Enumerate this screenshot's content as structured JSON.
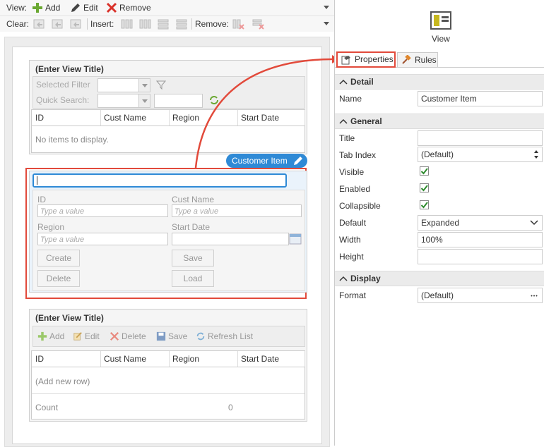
{
  "toolbar": {
    "view_label": "View:",
    "add": "Add",
    "edit": "Edit",
    "remove": "Remove",
    "clear_label": "Clear:",
    "insert_label": "Insert:",
    "remove2_label": "Remove:"
  },
  "list_view": {
    "title": "(Enter View Title)",
    "selected_filter": "Selected Filter",
    "quick_search": "Quick Search:",
    "columns": [
      "ID",
      "Cust Name",
      "Region",
      "Start Date"
    ],
    "empty": "No items to display."
  },
  "item_view": {
    "badge": "Customer Item",
    "labels": {
      "id": "ID",
      "cust_name": "Cust Name",
      "region": "Region",
      "start_date": "Start Date"
    },
    "placeholder": "Type a value",
    "buttons": {
      "create": "Create",
      "save": "Save",
      "delete": "Delete",
      "load": "Load"
    }
  },
  "edit_list_view": {
    "title": "(Enter View Title)",
    "actions": {
      "add": "Add",
      "edit": "Edit",
      "delete": "Delete",
      "save": "Save",
      "refresh": "Refresh List"
    },
    "columns": [
      "ID",
      "Cust Name",
      "Region",
      "Start Date"
    ],
    "add_row": "(Add new row)",
    "count_label": "Count",
    "count_value": "0"
  },
  "panel": {
    "view_label": "View",
    "tabs": {
      "properties": "Properties",
      "rules": "Rules"
    },
    "sections": {
      "detail": "Detail",
      "general": "General",
      "display": "Display"
    },
    "props": {
      "name_label": "Name",
      "name_value": "Customer Item",
      "title_label": "Title",
      "title_value": "",
      "tabindex_label": "Tab Index",
      "tabindex_value": "(Default)",
      "visible_label": "Visible",
      "enabled_label": "Enabled",
      "collapsible_label": "Collapsible",
      "default_label": "Default",
      "default_value": "Expanded",
      "width_label": "Width",
      "width_value": "100%",
      "height_label": "Height",
      "height_value": "",
      "format_label": "Format",
      "format_value": "(Default)"
    }
  },
  "colors": {
    "accent_red": "#e24a3b",
    "badge_blue": "#2f8ad6",
    "add_green": "#6aa832",
    "remove_red": "#d9322a"
  }
}
